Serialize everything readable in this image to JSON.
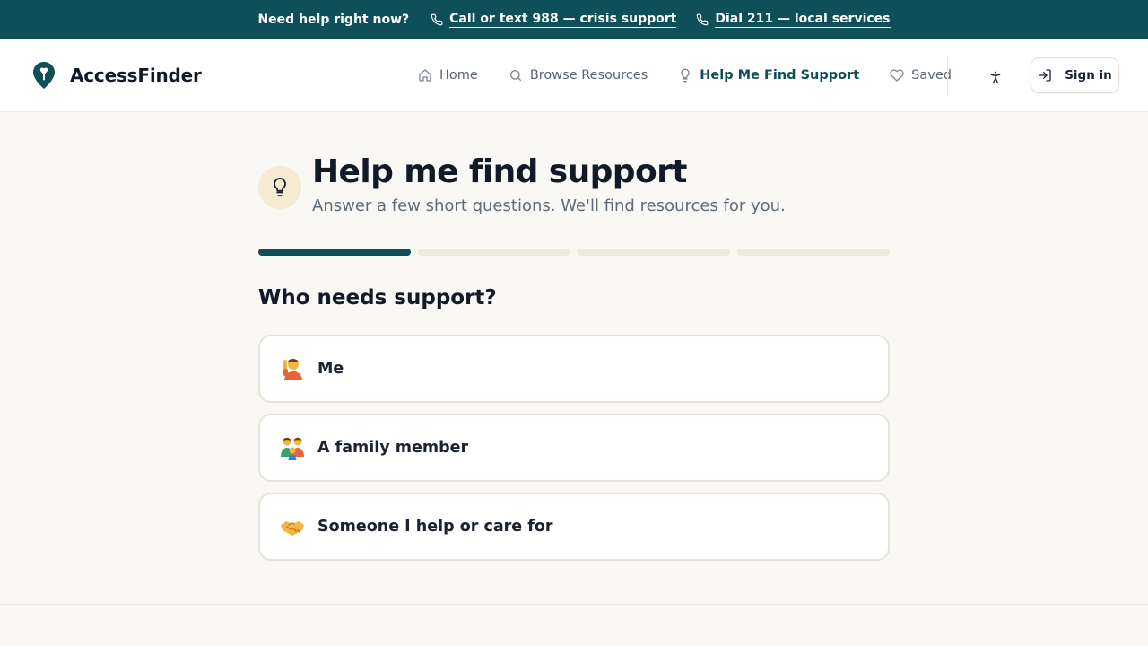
{
  "crisis": {
    "label": "Need help right now?",
    "call_link": "Call or text 988 — crisis support",
    "dial_link": "Dial 211 — local services"
  },
  "brand": {
    "name": "AccessFinder",
    "color": "#0f4f57"
  },
  "nav": {
    "items": [
      {
        "label": "Home",
        "icon": "home-icon"
      },
      {
        "label": "Browse Resources",
        "icon": "search-icon"
      },
      {
        "label": "Help Me Find Support",
        "icon": "lightbulb-icon",
        "active": true
      },
      {
        "label": "Saved",
        "icon": "heart-icon"
      }
    ],
    "accessibility_icon": "accessibility-icon",
    "signin_label": "Sign in"
  },
  "wizard": {
    "title": "Help me find support",
    "subtitle": "Answer a few short questions. We'll find resources for you.",
    "progress": {
      "current_step": 1,
      "total_steps": 4
    },
    "question": "Who needs support?",
    "options": [
      {
        "label": "Me",
        "icon": "person-raising-hand-icon"
      },
      {
        "label": "A family member",
        "icon": "family-icon"
      },
      {
        "label": "Someone I help or care for",
        "icon": "handshake-icon"
      }
    ]
  }
}
